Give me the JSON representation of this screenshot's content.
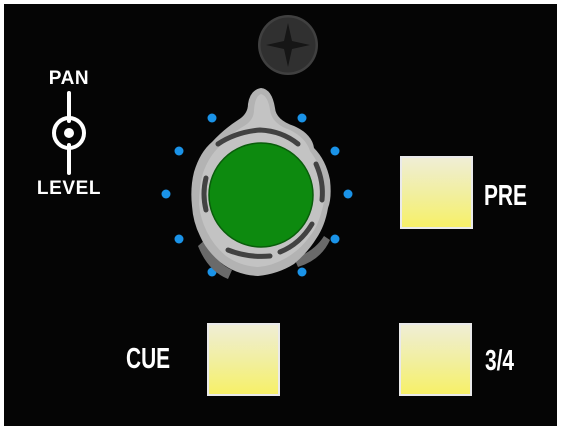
{
  "legend": {
    "top_text": "PAN",
    "bottom_text": "LEVEL",
    "icon": "rotary-indicator-icon"
  },
  "screw": {
    "icon": "screw-head-icon",
    "color": "#3a3a3a"
  },
  "knob": {
    "icon": "rotary-knob-icon",
    "cap_color": "#0d8a0f",
    "body_color": "#b8b8b8",
    "scale_dot_color": "#1a93e8"
  },
  "buttons": {
    "pre_label": "PRE",
    "cue_label": "CUE",
    "threefour_label": "3/4"
  },
  "colors": {
    "panel_background": "#050505",
    "label_text": "#ffffff",
    "button_top": "#f0eed5",
    "button_bottom": "#f7f068"
  }
}
